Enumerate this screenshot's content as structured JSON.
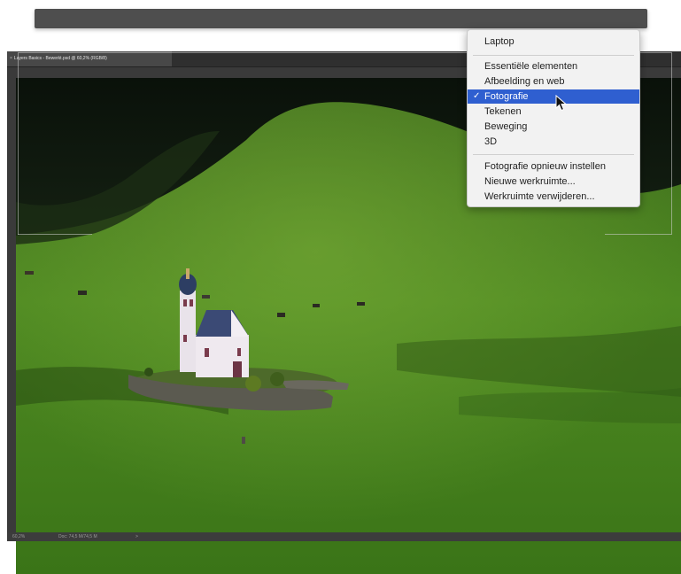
{
  "document": {
    "tab_close": "×",
    "tab_title": "Layers Basics - Bewerkt.psd @ 60,2% (RGB/8)"
  },
  "status": {
    "zoom": "60,2%",
    "doc_info": "Doc: 74,5 M/74,5 M",
    "arrow": ">"
  },
  "workspace_menu": {
    "laptop": "Laptop",
    "essentials": "Essentiële elementen",
    "graphic_web": "Afbeelding en web",
    "photography": "Fotografie",
    "photography_check": "✓",
    "painting": "Tekenen",
    "motion": "Beweging",
    "three_d": "3D",
    "reset": "Fotografie opnieuw instellen",
    "new_workspace": "Nieuwe werkruimte...",
    "delete_workspace": "Werkruimte verwijderen..."
  },
  "colors": {
    "menu_highlight": "#2f5fd0",
    "ui_dark": "#3a3a3a"
  },
  "icons": [
    "close-icon",
    "checkmark-icon",
    "pointer-cursor-icon"
  ]
}
